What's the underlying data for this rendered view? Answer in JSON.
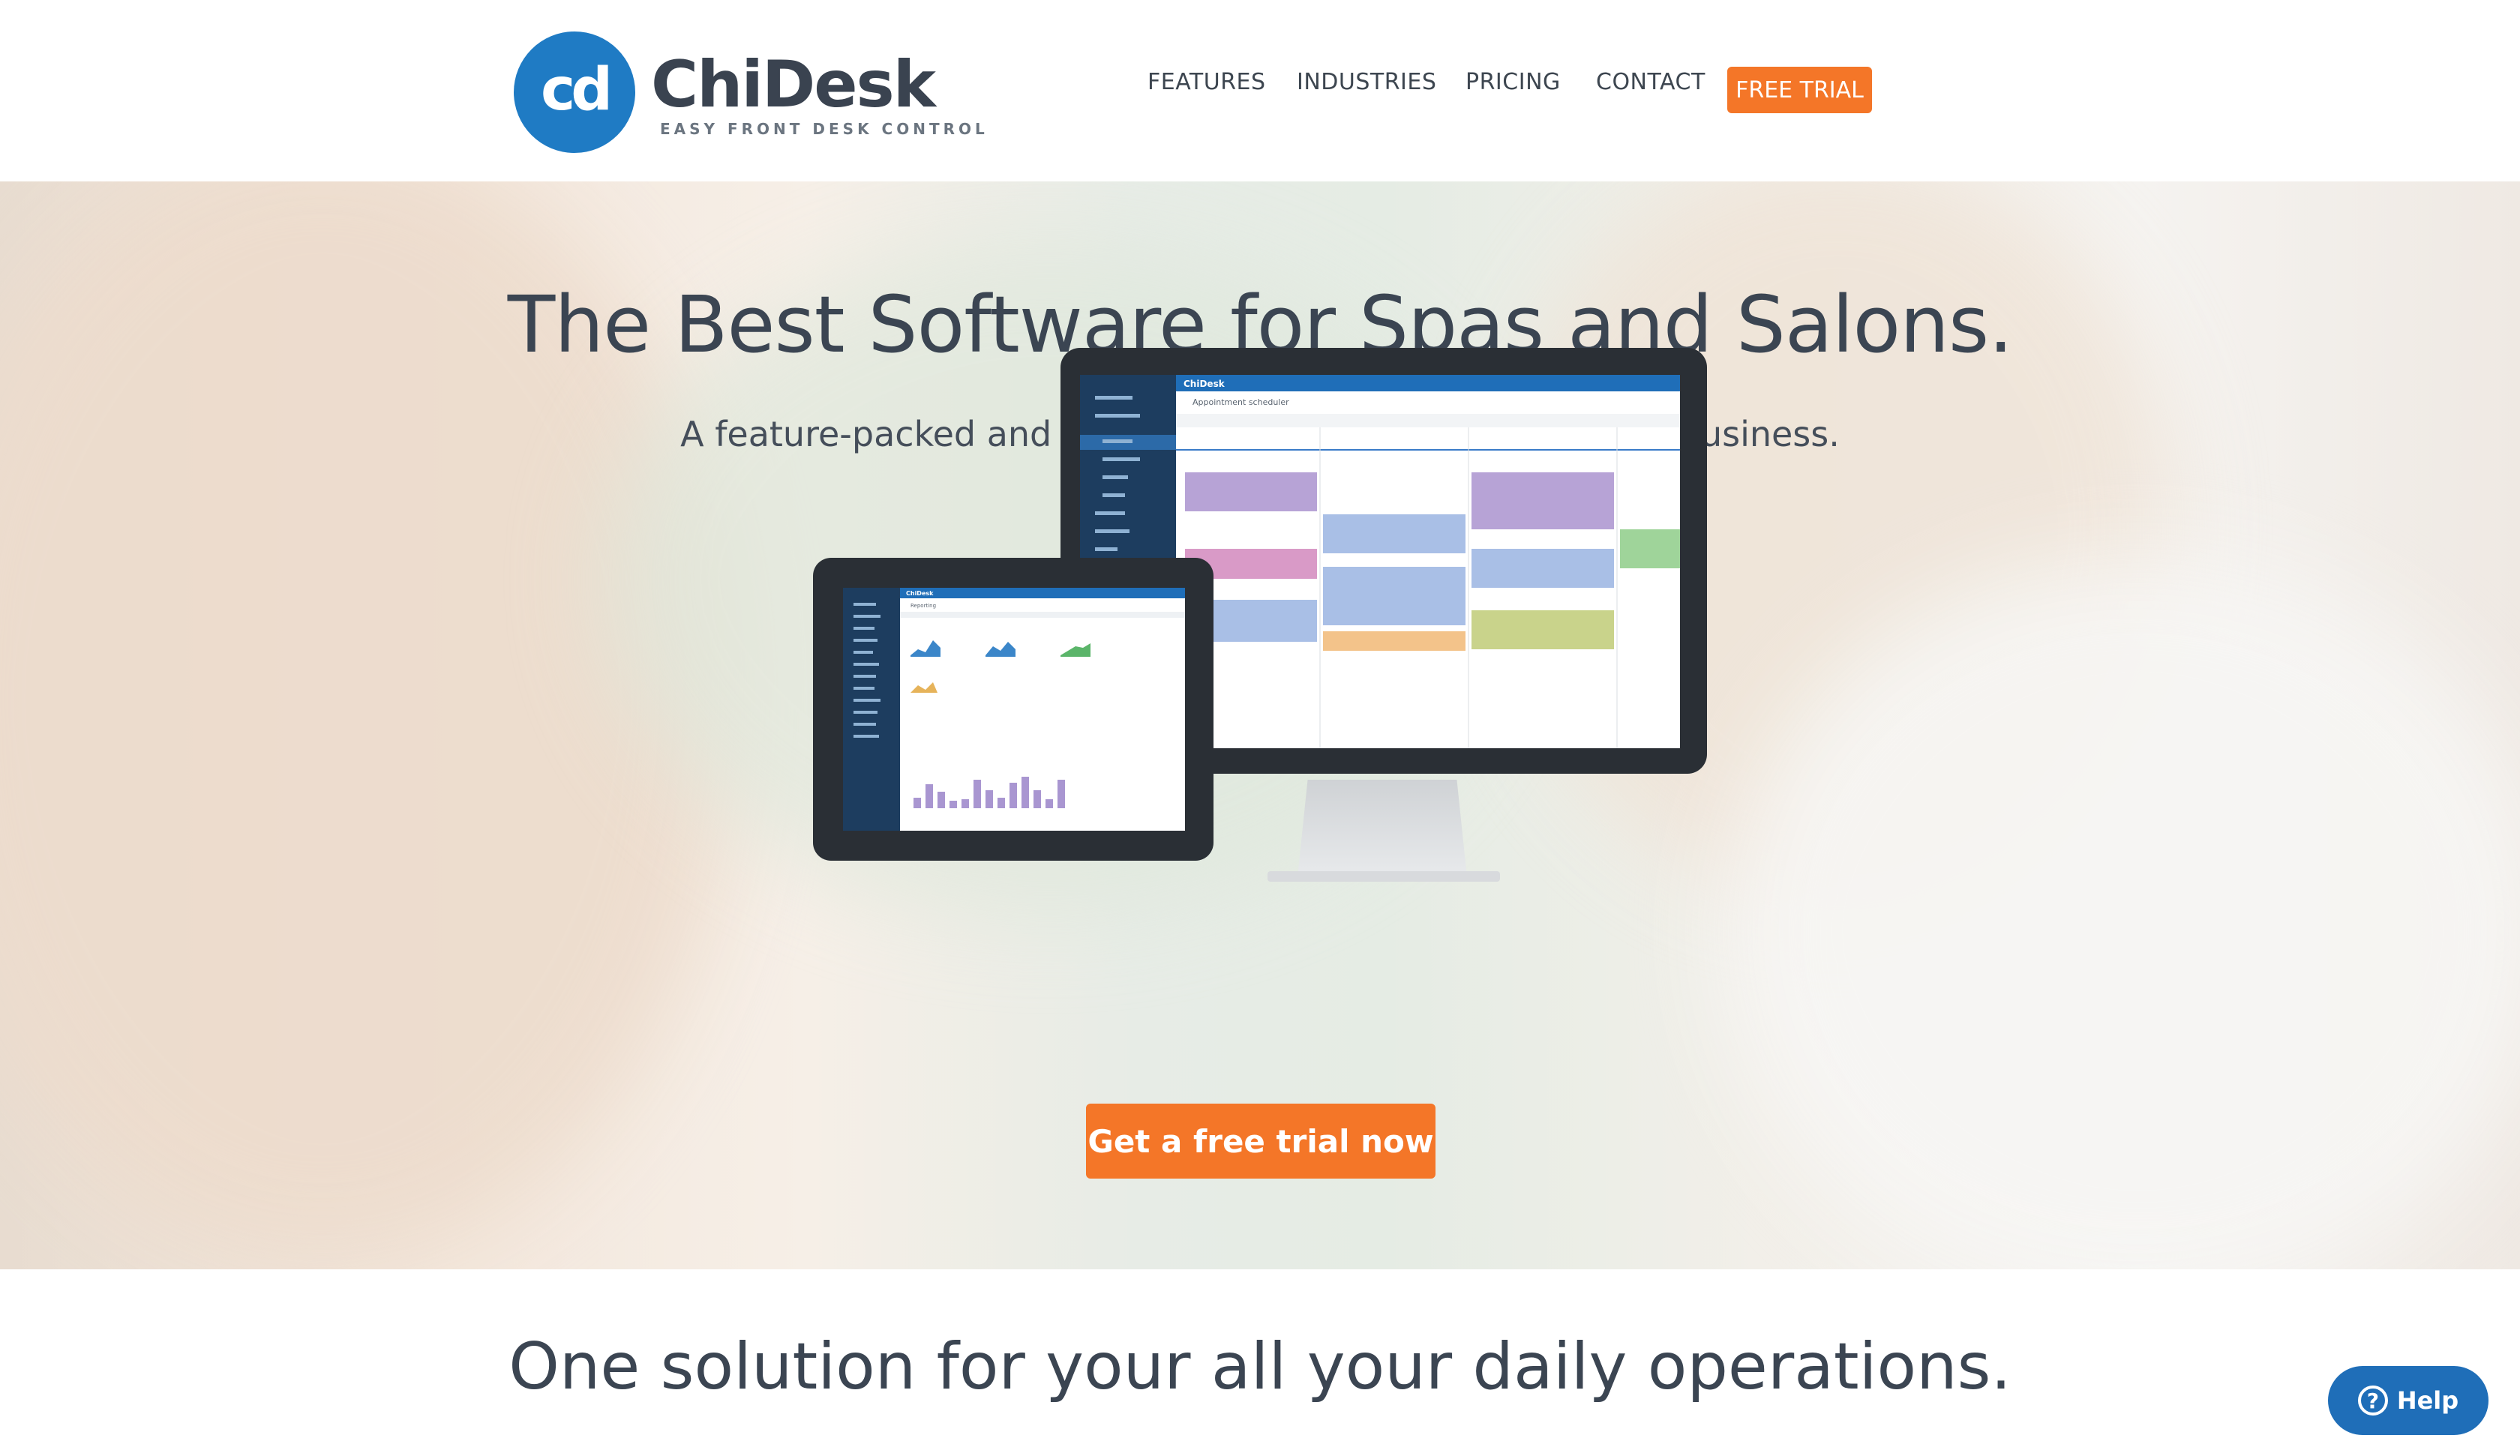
{
  "header": {
    "logo_mark": "cd",
    "brand_name": "ChiDesk",
    "tagline": "EASY FRONT DESK CONTROL",
    "nav": [
      {
        "label": "FEATURES"
      },
      {
        "label": "INDUSTRIES"
      },
      {
        "label": "PRICING"
      },
      {
        "label": "CONTACT"
      }
    ],
    "cta_label": "FREE TRIAL"
  },
  "hero": {
    "title": "The Best Software for Spas and Salons.",
    "subtitle": "A feature-packed and powerful booking software for your business.",
    "cta_label": "Get a free trial now",
    "monitor_app": {
      "title": "ChiDesk",
      "view": "Appointment scheduler"
    },
    "tablet_app": {
      "title": "ChiDesk",
      "view": "Reporting"
    }
  },
  "section2": {
    "title": "One solution for your all your daily operations."
  },
  "help": {
    "icon": "question-icon",
    "label": "Help"
  },
  "colors": {
    "accent": "#f47628",
    "brand": "#1f7bc4",
    "help": "#1f6eb8"
  }
}
